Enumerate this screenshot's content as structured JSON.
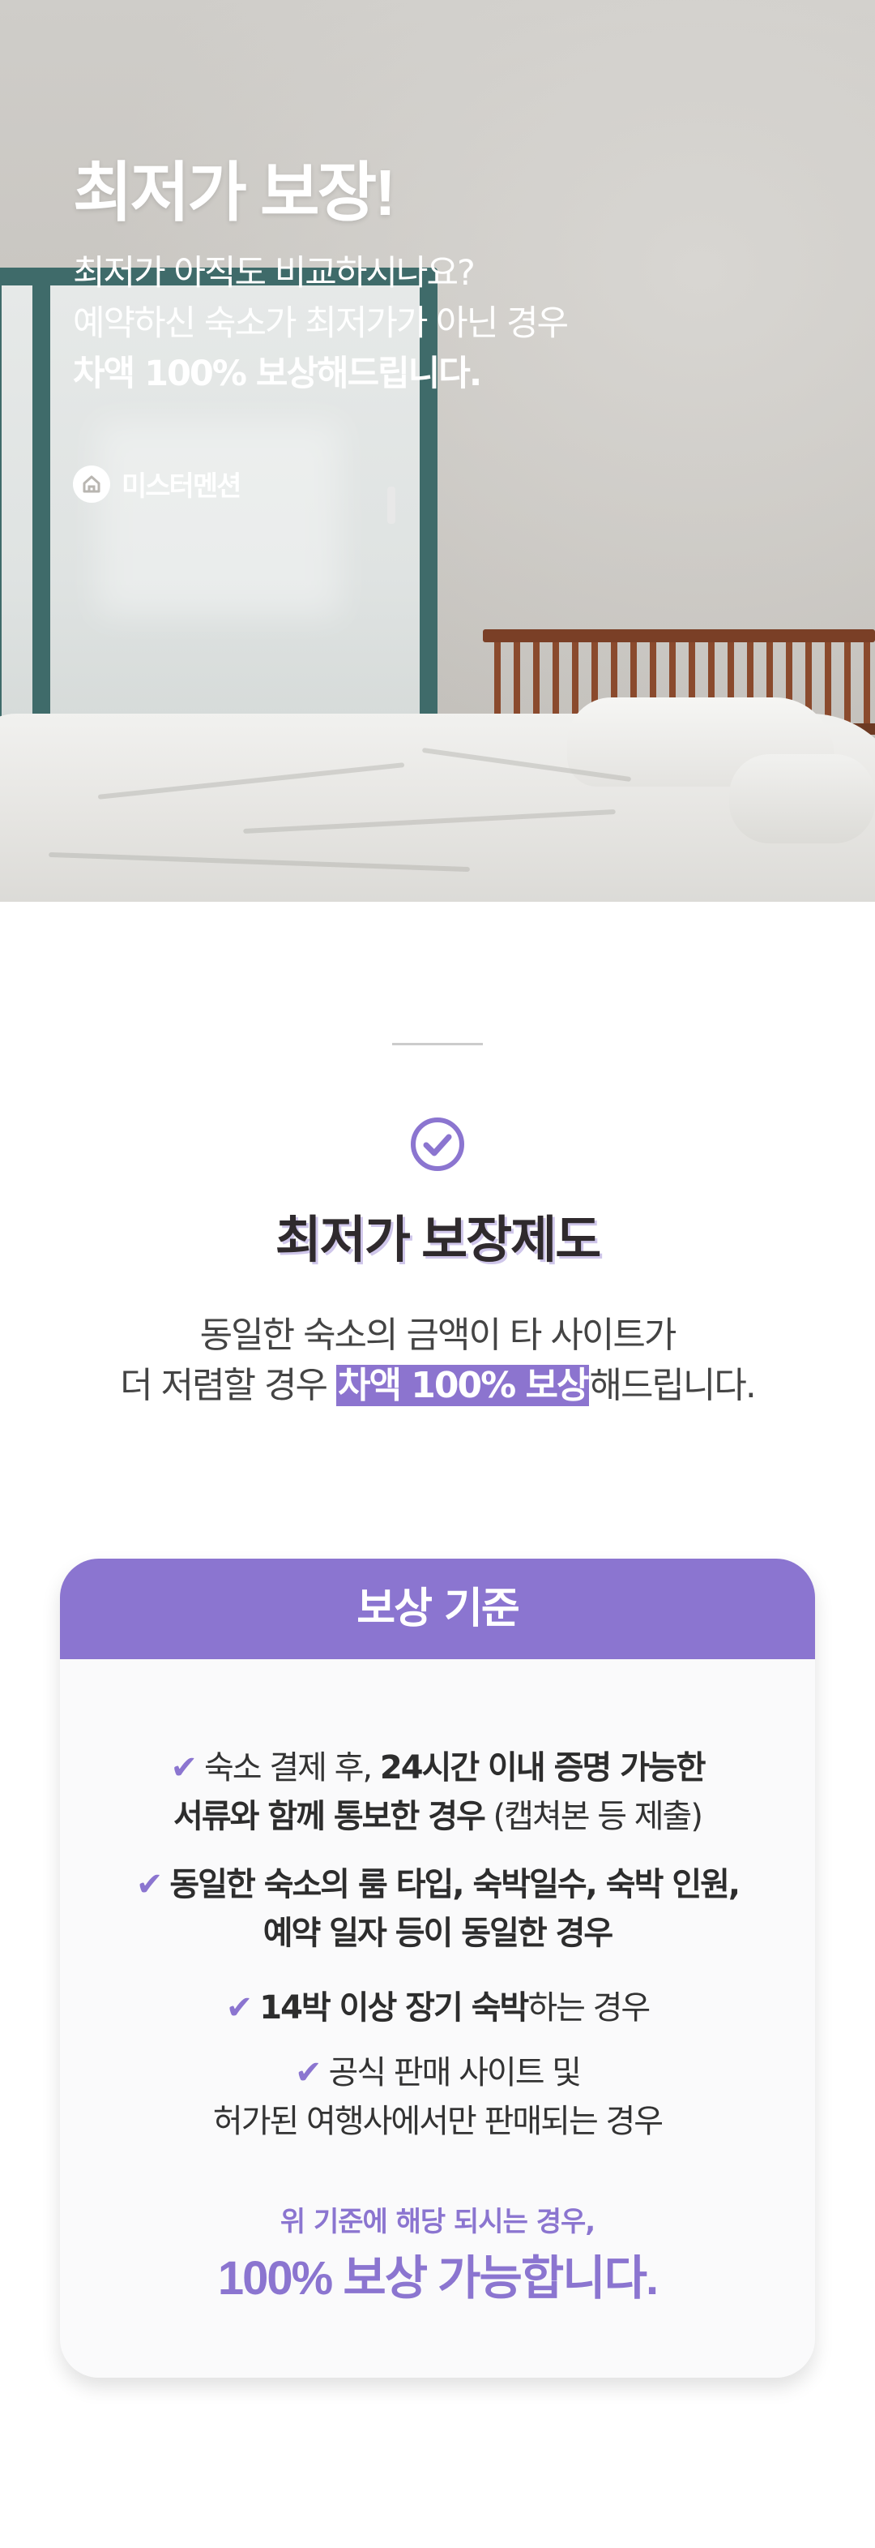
{
  "hero": {
    "title": "최저가 보장!",
    "line1": "최저가 아직도 비교하시나요?",
    "line2": "예약하신 숙소가 최저가가 아닌 경우",
    "line3": "차액 100% 보상해드립니다.",
    "brand": "미스터멘션",
    "brand_icon": "home-chat-icon"
  },
  "section": {
    "icon": "check-circle-icon",
    "title": "최저가 보장제도",
    "desc_line1": "동일한 숙소의 금액이 타 사이트가",
    "desc_line2_pre": "더 저렴할 경우 ",
    "desc_line2_highlight": "차액 100% 보상",
    "desc_line2_post": "해드립니다."
  },
  "card": {
    "header": "보상 기준",
    "check_icon": "checkmark-icon",
    "criteria": [
      {
        "l1_pre": "숙소 결제 후, ",
        "l1_bold": "24시간 이내 증명 가능한",
        "l2_bold": "서류와 함께 통보한 경우",
        "l2_post": " (캡쳐본 등 제출)"
      },
      {
        "l1_bold": "동일한 숙소의 룸 타입, 숙박일수, 숙박 인원,",
        "l2_bold": "예약 일자 등이 동일한 경우"
      },
      {
        "l1_bold": "14박 이상 장기 숙박",
        "l1_post": "하는 경우"
      },
      {
        "l1": "공식 판매 사이트 및",
        "l2": "허가된 여행사에서만 판매되는 경우"
      }
    ],
    "note": "위 기준에 해당 되시는 경우,",
    "big": "100% 보상 가능합니다."
  },
  "colors": {
    "accent": "#8b75d0",
    "highlight": "#8c74cf",
    "text": "#333333"
  }
}
